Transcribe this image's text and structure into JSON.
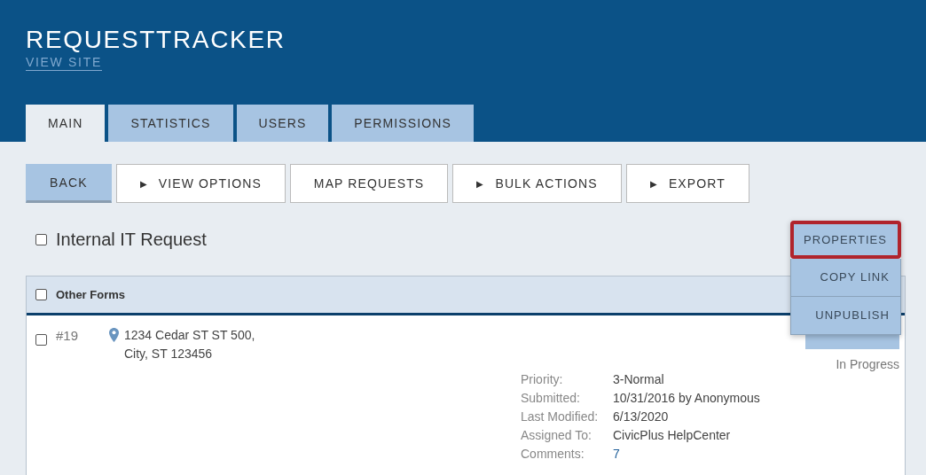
{
  "header": {
    "title": "REQUESTTRACKER",
    "link": "VIEW SITE"
  },
  "tabs": [
    {
      "label": "MAIN",
      "selected": true
    },
    {
      "label": "STATISTICS",
      "selected": false
    },
    {
      "label": "USERS",
      "selected": false
    },
    {
      "label": "PERMISSIONS",
      "selected": false
    }
  ],
  "toolbar": [
    {
      "label": "BACK",
      "kind": "primary"
    },
    {
      "label": "VIEW OPTIONS",
      "kind": "expander",
      "glyph": "▶"
    },
    {
      "label": "MAP REQUESTS",
      "kind": "plain"
    },
    {
      "label": "BULK ACTIONS",
      "kind": "expander",
      "glyph": "▶"
    },
    {
      "label": "EXPORT",
      "kind": "expander",
      "glyph": "▶"
    }
  ],
  "form": {
    "title": "Internal IT Request",
    "checked": false
  },
  "menu": [
    {
      "label": "PROPERTIES",
      "selected": true
    },
    {
      "label": "COPY LINK",
      "selected": false
    },
    {
      "label": "UNPUBLISH",
      "selected": false
    }
  ],
  "table": {
    "header": {
      "label": "Other Forms",
      "checked": false
    },
    "rows": [
      {
        "checked": false,
        "number": "#19",
        "address": [
          "1234 Cedar ST ST 500,",
          "City, ST 123456"
        ],
        "status": "In Progress",
        "details": [
          {
            "label": "Priority:",
            "value": "3-Normal",
            "kind": "text"
          },
          {
            "label": "Submitted:",
            "value": "10/31/2016 by Anonymous",
            "kind": "text"
          },
          {
            "label": "Last Modified:",
            "value": "6/13/2020",
            "kind": "text"
          },
          {
            "label": "Assigned To:",
            "value": "CivicPlus HelpCenter",
            "kind": "text"
          },
          {
            "label": "Comments:",
            "value": "7",
            "kind": "link"
          }
        ]
      }
    ]
  }
}
